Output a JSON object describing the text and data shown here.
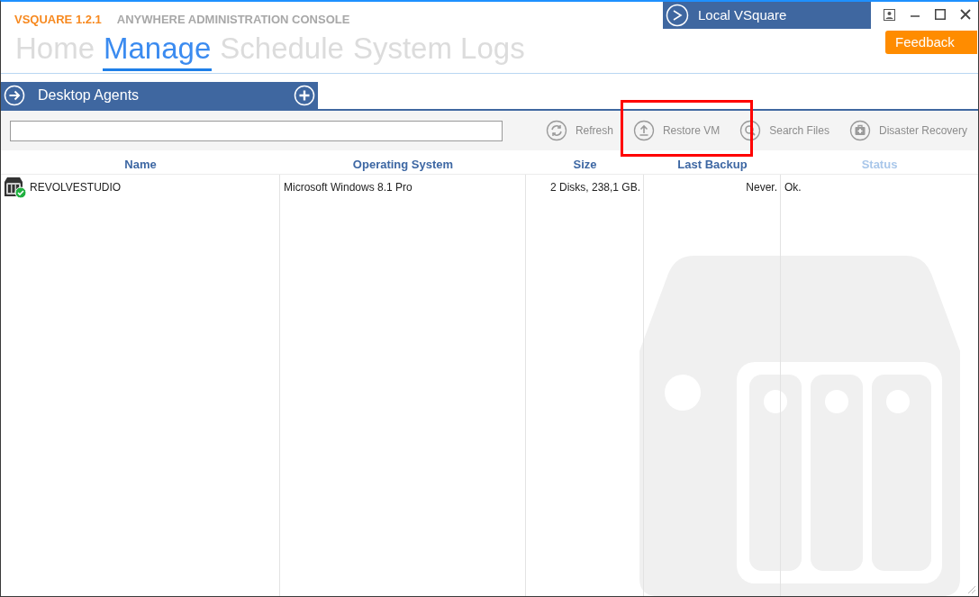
{
  "app": {
    "name": "VSQUARE 1.2.1",
    "subtitle": "ANYWHERE ADMINISTRATION CONSOLE"
  },
  "server": {
    "label": "Local VSquare"
  },
  "feedback": "Feedback",
  "tabs": [
    {
      "label": "Home",
      "selected": false
    },
    {
      "label": "Manage",
      "selected": true
    },
    {
      "label": "Schedule",
      "selected": false
    },
    {
      "label": "System Logs",
      "selected": false
    }
  ],
  "section": {
    "title": "Desktop Agents"
  },
  "toolbar": [
    {
      "label": "Refresh",
      "kind": "refresh"
    },
    {
      "label": "Restore VM",
      "kind": "restore"
    },
    {
      "label": "Search Files",
      "kind": "search"
    },
    {
      "label": "Disaster Recovery",
      "kind": "recovery"
    }
  ],
  "highlight": {
    "shown": true
  },
  "table": {
    "columns": [
      {
        "label": "Name",
        "dimmed": false
      },
      {
        "label": "Operating System",
        "dimmed": false
      },
      {
        "label": "Size",
        "dimmed": false
      },
      {
        "label": "Last Backup",
        "dimmed": false
      },
      {
        "label": "Status",
        "dimmed": true
      }
    ],
    "rows": [
      {
        "name": "REVOLVESTUDIO",
        "os": "Microsoft Windows 8.1 Pro",
        "size": "2 Disks, 238,1 GB.",
        "last_backup": "Never.",
        "status": "Ok.",
        "healthy": true
      }
    ]
  }
}
